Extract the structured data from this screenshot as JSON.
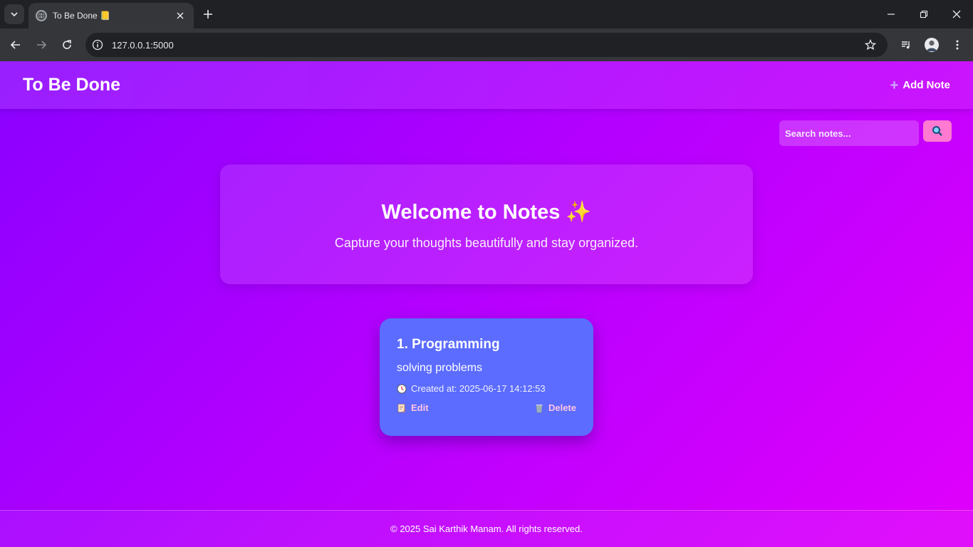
{
  "browser": {
    "tab_title": "To Be Done 📒",
    "url": "127.0.0.1:5000"
  },
  "header": {
    "brand": "To Be Done",
    "add_note_label": "Add Note",
    "add_note_icon": "plus-icon"
  },
  "search": {
    "placeholder": "Search notes...",
    "value": "",
    "button_icon": "search-icon"
  },
  "welcome": {
    "title": "Welcome to Notes ✨",
    "subtitle": "Capture your thoughts beautifully and stay organized."
  },
  "notes": [
    {
      "title": "1. Programming",
      "body": "solving problems",
      "created": "Created at: 2025-06-17 14:12:53",
      "edit_label": "Edit",
      "delete_label": "Delete"
    }
  ],
  "footer": {
    "text": "© 2025 Sai Karthik Manam. All rights reserved."
  },
  "colors": {
    "page_gradient_start": "#8a00ff",
    "page_gradient_end": "#e000fb",
    "card": "#5b6cff",
    "search_button": "#ff7ad0",
    "action_text": "#ffc4e4"
  }
}
